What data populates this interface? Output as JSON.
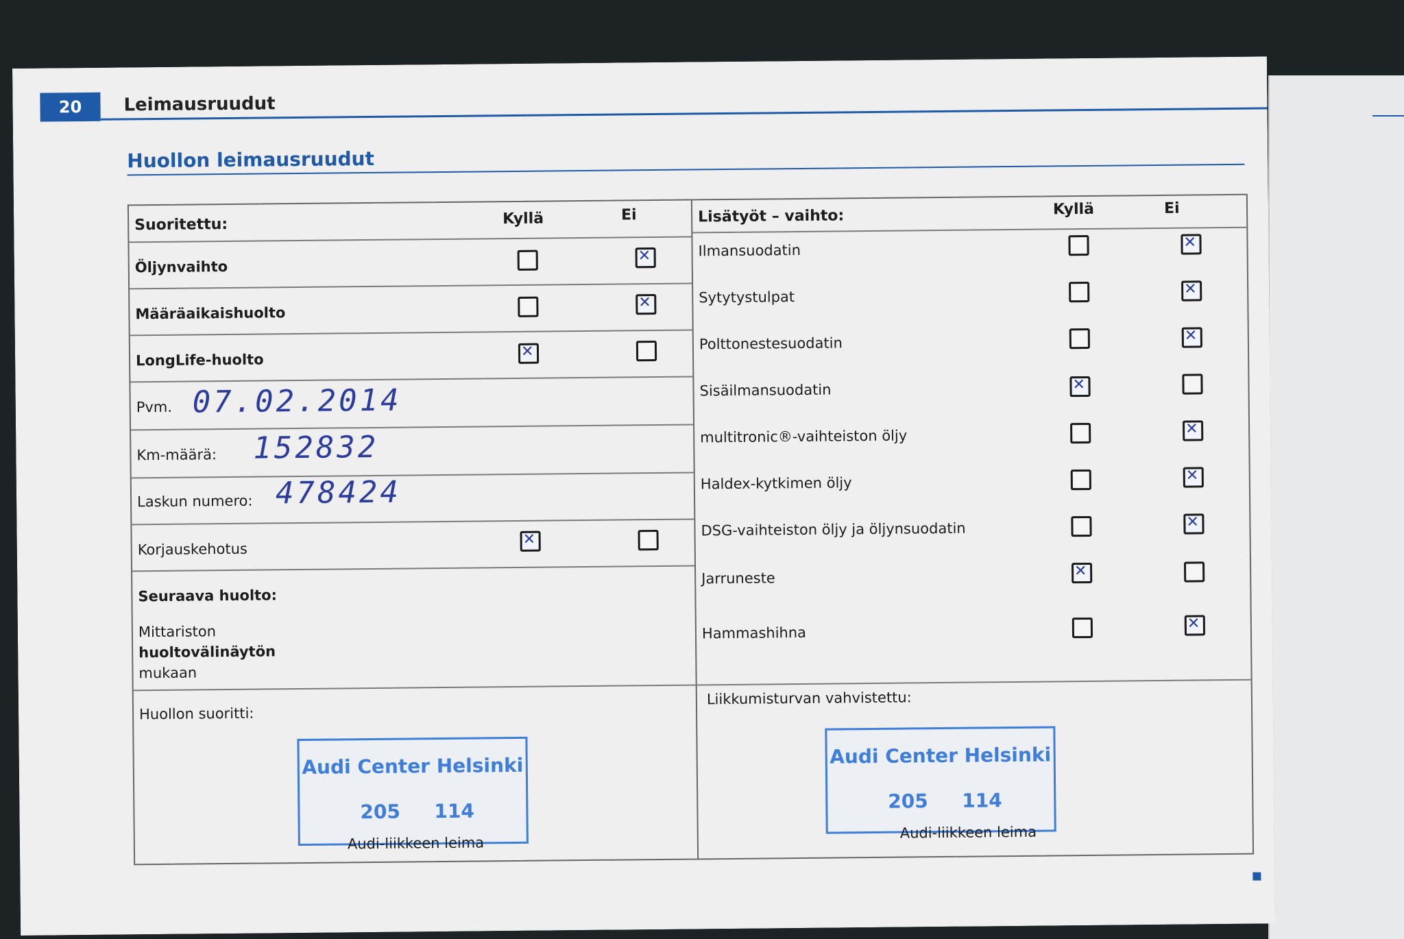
{
  "header": {
    "page_number": "20",
    "title": "Leimausruudut"
  },
  "section_title": "Huollon leimausruudut",
  "left": {
    "header": {
      "label": "Suoritettu:",
      "yes": "Kyllä",
      "no": "Ei"
    },
    "rows": [
      {
        "label": "Öljynvaihto",
        "yes": false,
        "no": true
      },
      {
        "label": "Määräaikaishuolto",
        "yes": false,
        "no": true
      },
      {
        "label": "LongLife-huolto",
        "yes": true,
        "no": false
      }
    ],
    "date": {
      "label": "Pvm.",
      "value": "07.02.2014"
    },
    "km": {
      "label": "Km-määrä:",
      "value": "152832"
    },
    "invoice": {
      "label": "Laskun numero:",
      "value": "478424"
    },
    "repair": {
      "label": "Korjauskehotus",
      "yes": true,
      "no": false
    },
    "next_service": {
      "label": "Seuraava huolto:"
    },
    "indicator": {
      "line1": "Mittariston",
      "line2": "huoltovälinäytön",
      "line3": "mukaan"
    },
    "performed_by": "Huollon suoritti:",
    "stamp": {
      "name": "Audi Center Helsinki",
      "num1": "205",
      "num2": "114"
    },
    "stamp_caption": "Audi-liikkeen leima"
  },
  "right": {
    "header": {
      "label": "Lisätyöt – vaihto:",
      "yes": "Kyllä",
      "no": "Ei"
    },
    "rows": [
      {
        "label": "Ilmansuodatin",
        "yes": false,
        "no": true
      },
      {
        "label": "Sytytystulpat",
        "yes": false,
        "no": true
      },
      {
        "label": "Polttonestesuodatin",
        "yes": false,
        "no": true
      },
      {
        "label": "Sisäilmansuodatin",
        "yes": true,
        "no": false
      },
      {
        "label": "multitronic®-vaihteiston öljy",
        "yes": false,
        "no": true
      },
      {
        "label": "Haldex-kytkimen öljy",
        "yes": false,
        "no": true
      },
      {
        "label": "DSG-vaihteiston öljy ja öljynsuodatin",
        "yes": false,
        "no": true
      },
      {
        "label": "Jarruneste",
        "yes": true,
        "no": false
      },
      {
        "label": "Hammashihna",
        "yes": false,
        "no": true
      }
    ],
    "safety": "Liikkumisturvan vahvistettu:",
    "stamp": {
      "name": "Audi Center Helsinki",
      "num1": "205",
      "num2": "114"
    },
    "stamp_caption": "Audi-liikkeen leima"
  }
}
